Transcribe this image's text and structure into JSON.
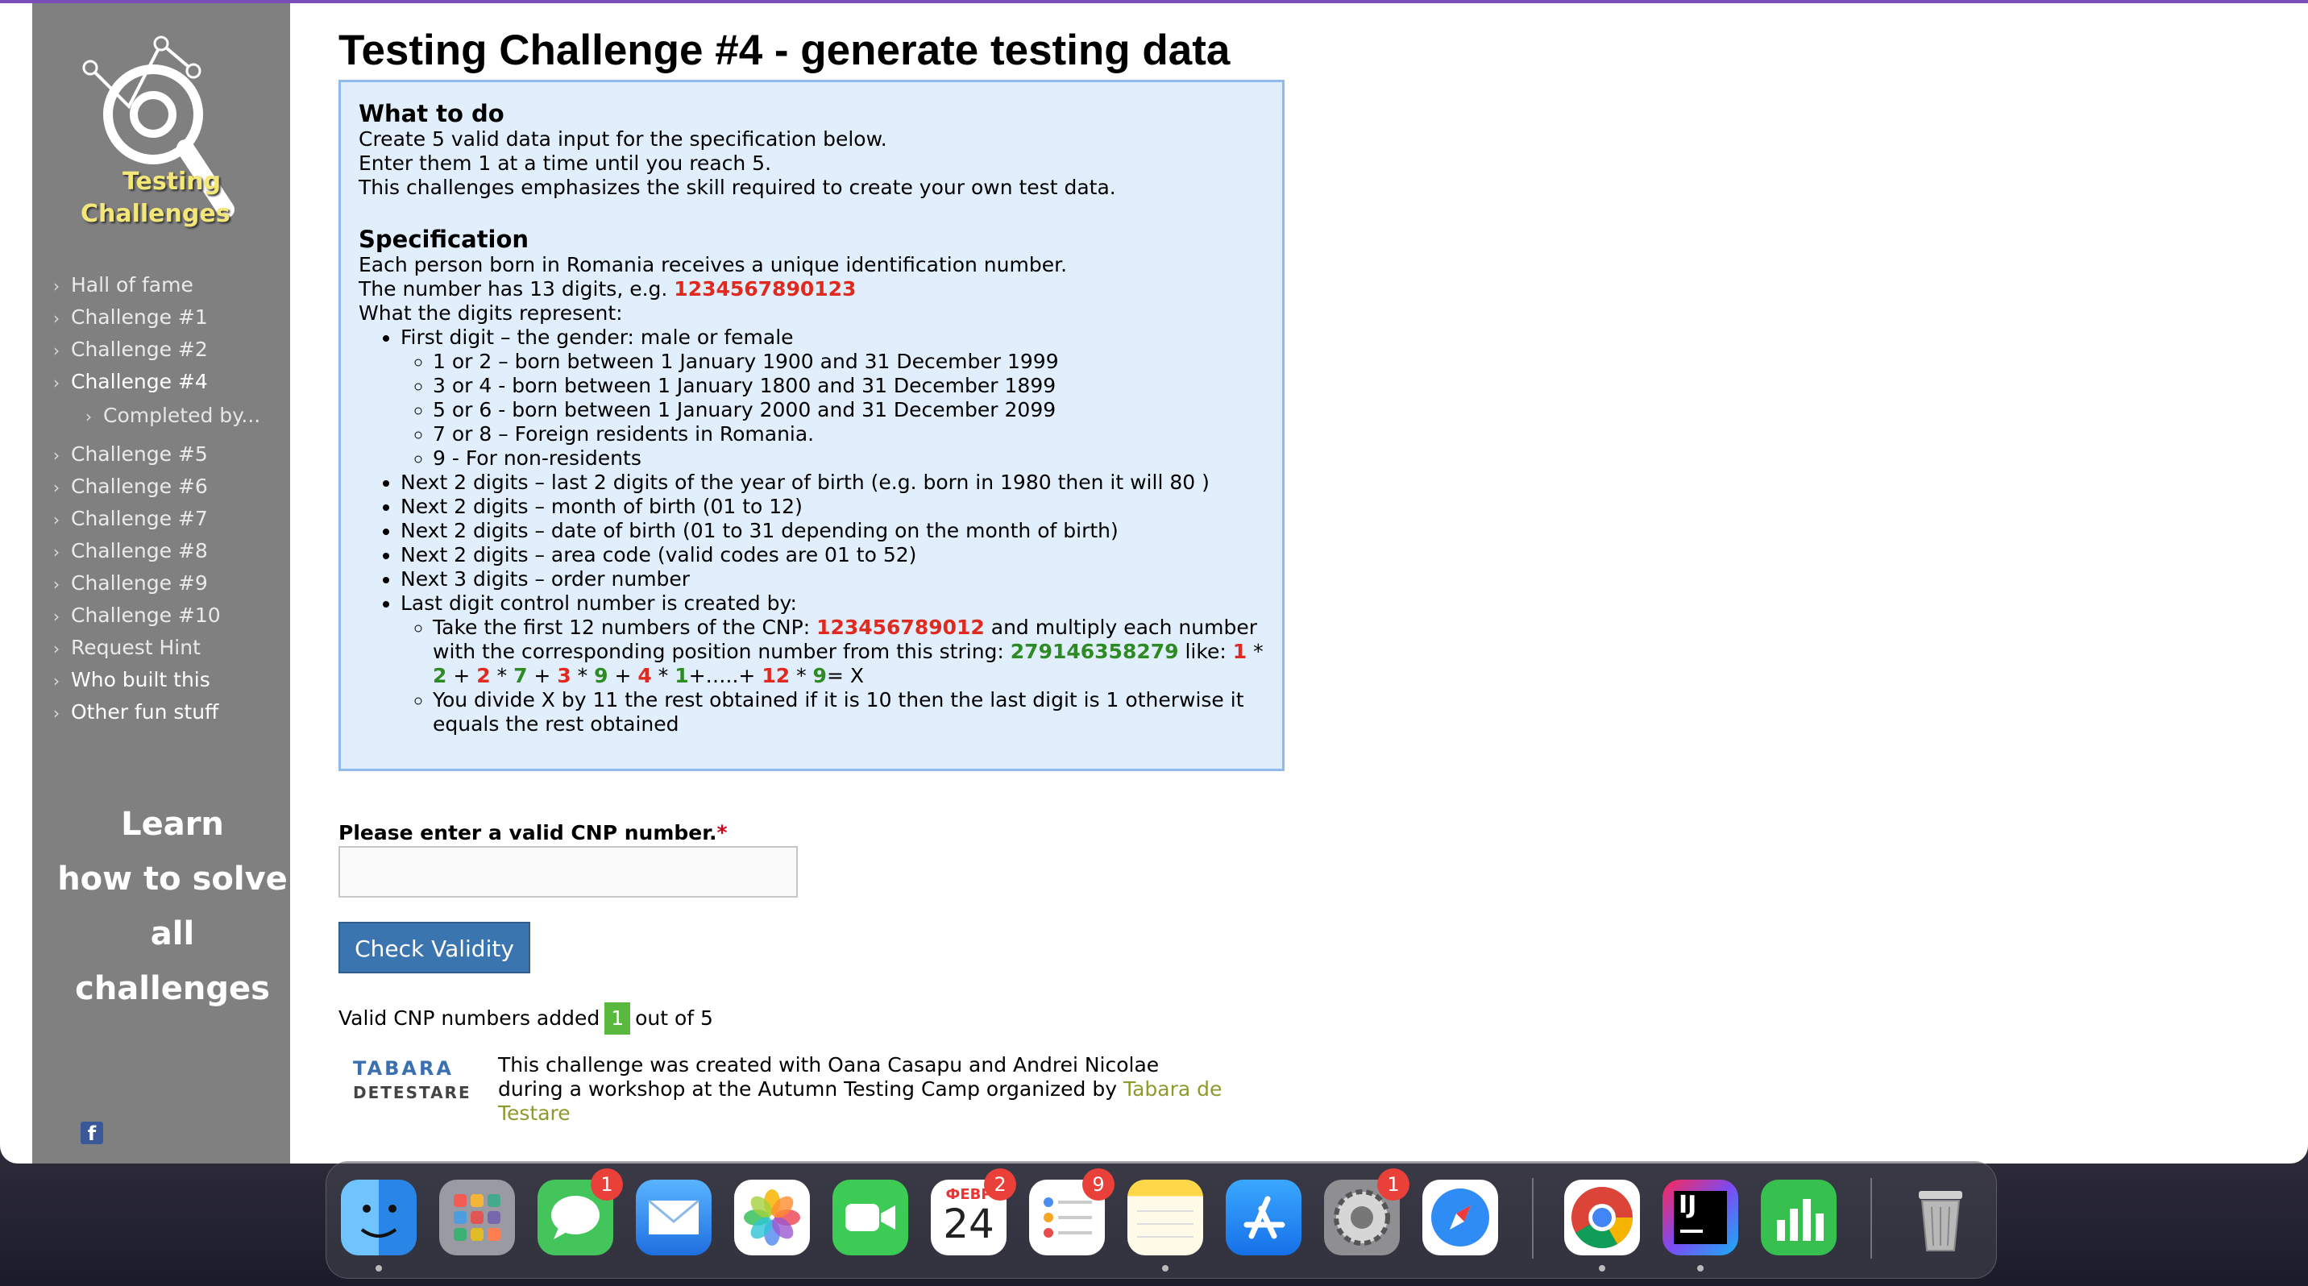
{
  "sidebar": {
    "logo": {
      "line1": "Testing",
      "line2": "Challenges"
    },
    "nav": [
      {
        "label": "Hall of fame"
      },
      {
        "label": "Challenge #1"
      },
      {
        "label": "Challenge #2"
      },
      {
        "label": "Challenge #4"
      },
      {
        "label": "Completed by..."
      },
      {
        "label": "Challenge #5"
      },
      {
        "label": "Challenge #6"
      },
      {
        "label": "Challenge #7"
      },
      {
        "label": "Challenge #8"
      },
      {
        "label": "Challenge #9"
      },
      {
        "label": "Challenge #10"
      },
      {
        "label": "Request Hint"
      },
      {
        "label": "Who built this"
      },
      {
        "label": "Other fun stuff"
      }
    ],
    "learn": [
      "Learn",
      "how to solve",
      "all challenges"
    ],
    "facebook_glyph": "f"
  },
  "main": {
    "title": "Testing Challenge #4 - generate testing data",
    "what_to_do": {
      "heading": "What to do",
      "lines": [
        "Create 5 valid data input for the specification below.",
        "Enter them 1 at a time until you reach 5.",
        "This challenges emphasizes the skill required to create your own test data."
      ]
    },
    "spec": {
      "heading": "Specification",
      "line1": "Each person born in Romania receives a unique identification number.",
      "line2_prefix": "The number has 13 digits, e.g. ",
      "example_number": "1234567890123",
      "line3": "What the digits represent:",
      "first_digit": "First digit – the gender: male or female",
      "gender_items": [
        "1 or 2 – born between 1 January 1900 and 31 December 1999",
        "3 or 4 - born between 1 January 1800 and 31 December 1899",
        "5 or 6 - born between 1 January 2000 and 31 December 2099",
        "7 or 8 – Foreign residents in Romania.",
        "9 - For non-residents"
      ],
      "digit_items": [
        "Next 2 digits – last 2 digits of the year of birth (e.g. born in 1980 then it will 80 )",
        "Next 2 digits – month of birth (01 to 12)",
        "Next 2 digits – date of birth (01 to 31 depending on the month of birth)",
        "Next 2 digits – area code (valid codes are 01 to 52)",
        "Next 3 digits – order number",
        "Last digit control number is created by:"
      ],
      "control": {
        "p1": "Take the first 12 numbers of the CNP: ",
        "cnp12": "123456789012",
        "p2": " and multiply each number with the corresponding position number from this string: ",
        "key": "279146358279",
        "p3": " like: ",
        "a1": "1",
        "s1": " * ",
        "b1": "2",
        "s2": " + ",
        "a2": "2",
        "s3": " * ",
        "b2": "7",
        "s4": " + ",
        "a3": "3",
        "s5": " * ",
        "b3": "9",
        "s6": " + ",
        "a4": "4",
        "s7": " * ",
        "b4": "1",
        "s8": "+…..+ ",
        "a5": "12",
        "s9": " * ",
        "b5": "9",
        "s10": "= X",
        "p4": "You divide X by 11 the rest obtained if it is 10 then the last digit is 1 otherwise it equals the rest obtained"
      }
    },
    "form": {
      "label": "Please enter a valid CNP number.",
      "required_mark": "*",
      "input_value": "",
      "button": "Check Validity"
    },
    "counter": {
      "prefix": "Valid CNP numbers added",
      "count": "1",
      "suffix": "out of 5"
    },
    "credit": {
      "logo_line1": "TABARA",
      "logo_line2": "DETESTARE",
      "text1": "This challenge was created with Oana Casapu and Andrei Nicolae during a workshop at the Autumn Testing Camp organized by ",
      "link": "Tabara de Testare"
    }
  },
  "dock": {
    "calendar_month": "ФЕВР",
    "calendar_day": "24",
    "badges": {
      "messages": "1",
      "calendar": "2",
      "reminders": "9",
      "settings": "1"
    },
    "intellij_label": "IJ"
  },
  "colors": {
    "accent_red": "#e02a1f",
    "accent_green": "#2e8a23",
    "button_blue": "#3a75b0",
    "sidebar_gray": "#808080"
  }
}
